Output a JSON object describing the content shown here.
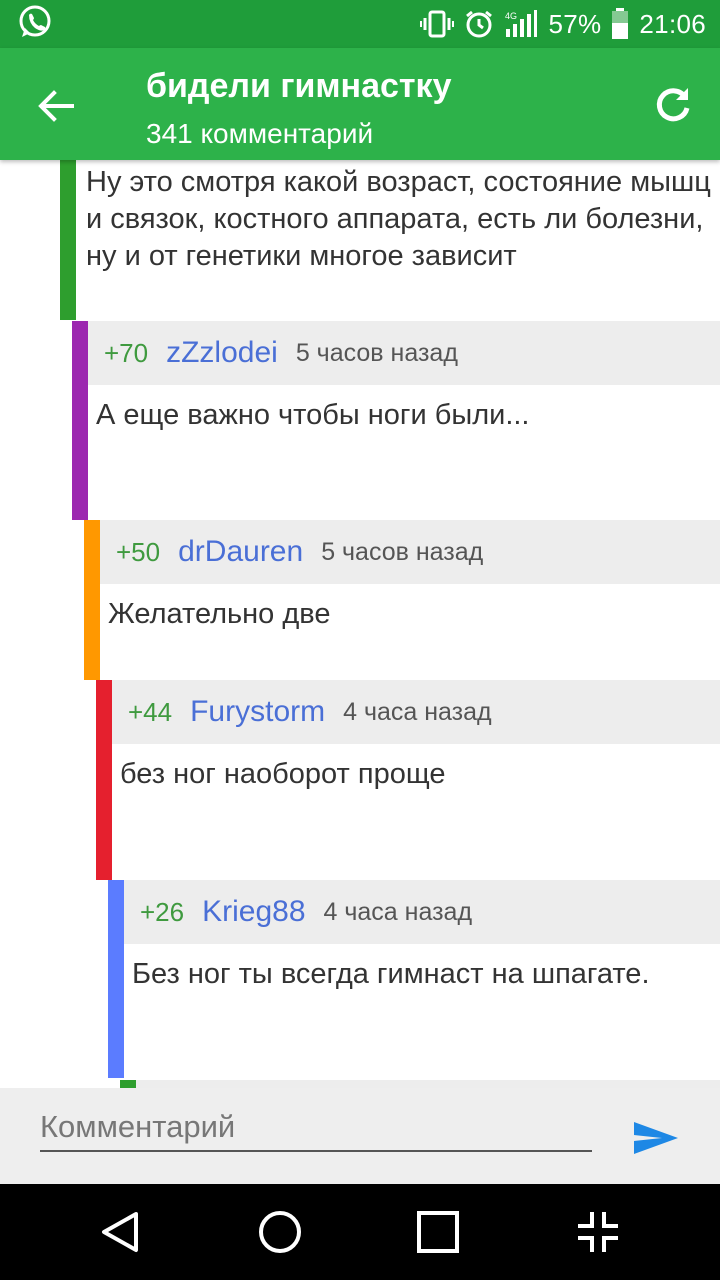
{
  "status_bar": {
    "battery": "57%",
    "time": "21:06",
    "network": "4G",
    "icons": [
      "whatsapp-icon",
      "vibrate-icon",
      "alarm-icon",
      "signal-icon",
      "battery-icon"
    ]
  },
  "app_bar": {
    "title": "бидели гимнастку",
    "subtitle": "341 комментарий",
    "icons": [
      "back-arrow-icon",
      "refresh-icon"
    ]
  },
  "comments": [
    {
      "text": "Ну это смотря какой возраст, состояние мышц и связок, костного аппарата, есть ли болезни, ну и от генетики многое зависит",
      "color": "#2e9e2e"
    },
    {
      "score": "+70",
      "author": "zZzlodei",
      "time": "5 часов назад",
      "text": "А еще важно чтобы ноги были...",
      "color": "#9c27b0"
    },
    {
      "score": "+50",
      "author": "drDauren",
      "time": "5 часов назад",
      "text": "Желательно две",
      "color": "#ff9800"
    },
    {
      "score": "+44",
      "author": "Furystorm",
      "time": "4 часа назад",
      "text": "без ног наоборот проще",
      "color": "#e5202e"
    },
    {
      "score": "+26",
      "author": "Krieg88",
      "time": "4 часа назад",
      "text": "Без ног ты всегда гимнаст на шпагате.",
      "color": "#5b7cff"
    }
  ],
  "next_thread_color": "#2e9e2e",
  "input": {
    "placeholder": "Комментарий"
  },
  "nav_bar": {
    "icons": [
      "back-triangle-icon",
      "home-circle-icon",
      "recents-square-icon",
      "collapse-icon"
    ]
  },
  "colors": {
    "status_bar": "#1f9d3a",
    "app_bar": "#2db24a",
    "send": "#1e88e5"
  }
}
